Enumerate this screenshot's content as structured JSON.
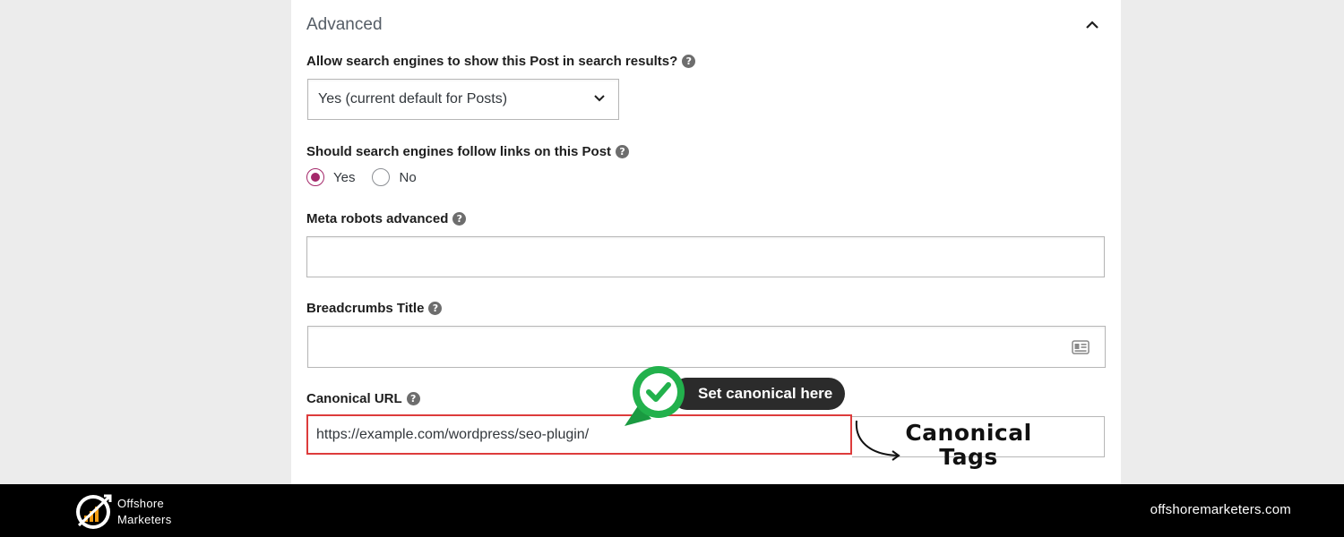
{
  "section": {
    "title": "Advanced"
  },
  "search_visibility": {
    "label": "Allow search engines to show this Post in search results?",
    "selected": "Yes (current default for Posts)"
  },
  "follow_links": {
    "label": "Should search engines follow links on this Post",
    "options": [
      "Yes",
      "No"
    ],
    "selected": "Yes"
  },
  "meta_robots": {
    "label": "Meta robots advanced",
    "value": ""
  },
  "breadcrumbs": {
    "label": "Breadcrumbs Title",
    "value": ""
  },
  "canonical": {
    "label": "Canonical URL",
    "value": "https://example.com/wordpress/seo-plugin/"
  },
  "annotation": {
    "badge_text": "Set canonical here",
    "label_line1": "Canonical",
    "label_line2": "Tags"
  },
  "footer": {
    "brand_line1": "Offshore",
    "brand_line2": "Marketers",
    "website": "offshoremarketers.com"
  },
  "colors": {
    "accent_radio": "#a4286a",
    "highlight_border": "#dd3c3c",
    "badge_green": "#22b14c",
    "badge_dark": "#2b2b2b",
    "footer_bg": "#000000",
    "logo_orange": "#f39c12"
  },
  "icons": [
    "chevron-up-icon",
    "chevron-down-icon",
    "help-icon",
    "contact-card-icon",
    "check-icon",
    "curved-arrow-icon",
    "logo-icon"
  ]
}
